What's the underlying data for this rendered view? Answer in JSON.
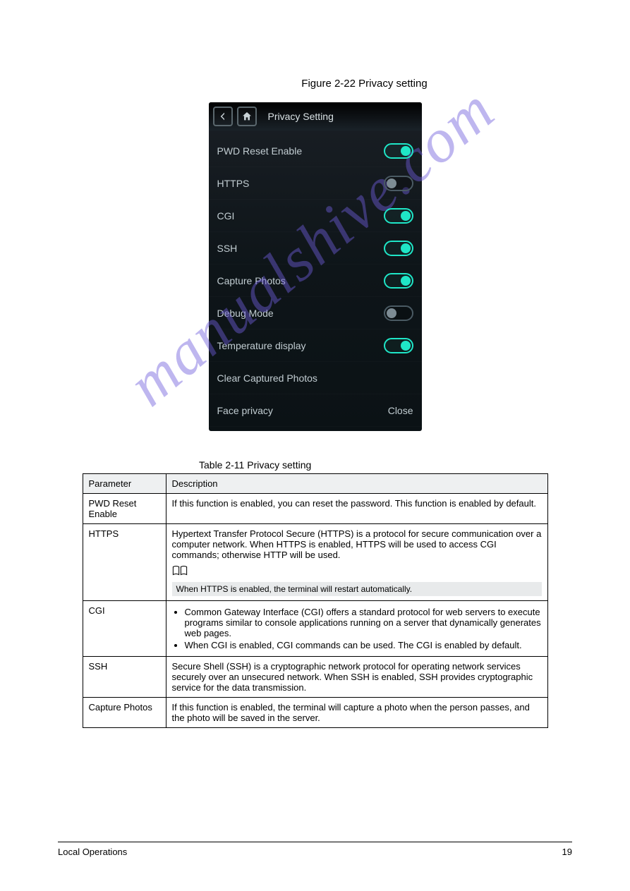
{
  "figure_caption": "Figure 2-22 Privacy setting",
  "device": {
    "title": "Privacy Setting",
    "rows": [
      {
        "label": "PWD Reset Enable",
        "state": "on"
      },
      {
        "label": "HTTPS",
        "state": "off"
      },
      {
        "label": "CGI",
        "state": "on"
      },
      {
        "label": "SSH",
        "state": "on"
      },
      {
        "label": "Capture Photos",
        "state": "on"
      },
      {
        "label": "Debug Mode",
        "state": "off"
      },
      {
        "label": "Temperature display",
        "state": "on"
      },
      {
        "label": "Clear Captured Photos",
        "state": "none"
      },
      {
        "label": "Face privacy",
        "state": "value",
        "value": "Close"
      }
    ]
  },
  "table_caption": "Table 2-11 Privacy setting",
  "headers": {
    "param": "Parameter",
    "desc": "Description"
  },
  "rows": [
    {
      "param": "PWD Reset Enable",
      "desc": "If this function is enabled, you can reset the password. This function is enabled by default."
    },
    {
      "param": "HTTPS",
      "desc_main": "Hypertext Transfer Protocol Secure (HTTPS) is a protocol for secure communication over a computer network.\nWhen HTTPS is enabled, HTTPS will be used to access CGI commands; otherwise HTTP will be used.",
      "note": "When HTTPS is enabled, the terminal will restart automatically."
    },
    {
      "param": "CGI",
      "desc_lines": [
        "Common Gateway Interface (CGI) offers a standard protocol for web servers to execute programs similar to console applications running on a server that dynamically generates web pages.",
        "When CGI is enabled, CGI commands can be used. The CGI is enabled by default."
      ]
    },
    {
      "param": "SSH",
      "desc": "Secure Shell (SSH) is a cryptographic network protocol for operating network services securely over an unsecured network.\nWhen SSH is enabled, SSH provides cryptographic service for the data transmission."
    },
    {
      "param": "Capture Photos",
      "desc": "If this function is enabled, the terminal will capture a photo when the person passes, and the photo will be saved in the server."
    }
  ],
  "footer": {
    "left": "Local Operations",
    "right": "19"
  },
  "watermark": "manualshive.com"
}
